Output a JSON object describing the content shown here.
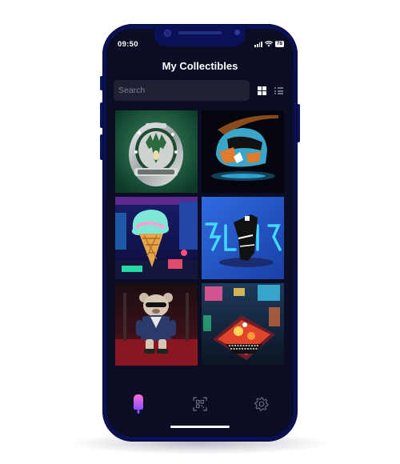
{
  "status_bar": {
    "time": "09:50",
    "battery": "78"
  },
  "header": {
    "title": "My Collectibles"
  },
  "search": {
    "placeholder": "Search"
  },
  "view_toggle": {
    "grid_icon": "grid-view-icon",
    "list_icon": "list-view-icon",
    "active": "grid"
  },
  "collectibles": [
    {
      "name": "championship-ring",
      "icon": "ring-image"
    },
    {
      "name": "racing-helmet",
      "icon": "helmet-image"
    },
    {
      "name": "ice-cream-cone",
      "icon": "ice-cream-image"
    },
    {
      "name": "neon-sneaker",
      "icon": "sneaker-image"
    },
    {
      "name": "teddy-bear",
      "icon": "teddy-bear-image"
    },
    {
      "name": "neon-pinball",
      "icon": "pinball-image"
    }
  ],
  "tab_bar": {
    "items": [
      {
        "icon": "popsicle-icon",
        "active": true
      },
      {
        "icon": "scan-qr-icon",
        "active": false
      },
      {
        "icon": "settings-gear-icon",
        "active": false
      }
    ]
  },
  "colors": {
    "phone_frame": "#0b1157",
    "screen_bg": "#0b0d24",
    "search_bg": "#1e2034",
    "accent_gradient_start": "#ff6fd0",
    "accent_gradient_end": "#8a4dff"
  }
}
